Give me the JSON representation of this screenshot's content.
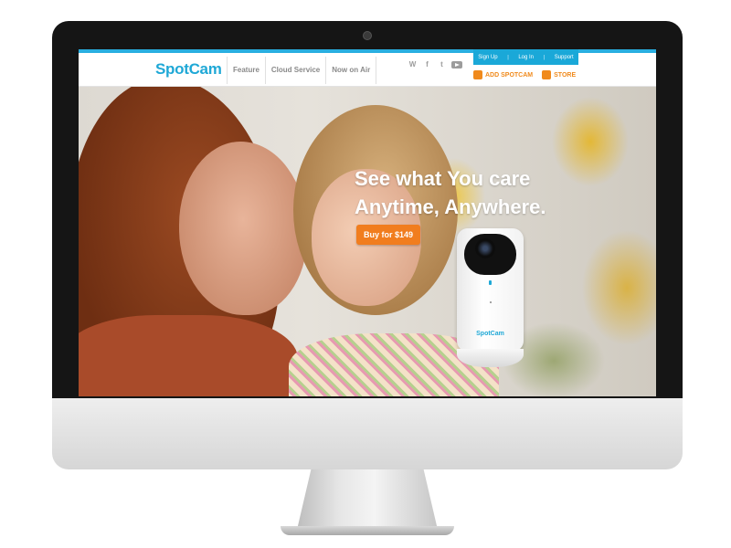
{
  "brand": {
    "logo": "SpotCam"
  },
  "nav": {
    "items": [
      "Feature",
      "Cloud Service",
      "Now on Air"
    ]
  },
  "social": {
    "icons": [
      "weibo-icon",
      "facebook-icon",
      "twitter-icon",
      "youtube-icon"
    ],
    "weibo_glyph": "W",
    "facebook_glyph": "f",
    "twitter_glyph": "t"
  },
  "account": {
    "sign_up": "Sign Up",
    "log_in": "Log In",
    "support": "Support",
    "separator": "|"
  },
  "actions": {
    "add_spotcam": "ADD SPOTCAM",
    "store": "STORE"
  },
  "hero": {
    "headline_line1": "See what You care",
    "headline_line2": "Anytime, Anywhere.",
    "cta_label": "Buy for $149",
    "camera_brand": "SpotCam"
  },
  "colors": {
    "accent": "#1fa8d6",
    "cta": "#f17d1e",
    "action": "#f08a1c"
  }
}
